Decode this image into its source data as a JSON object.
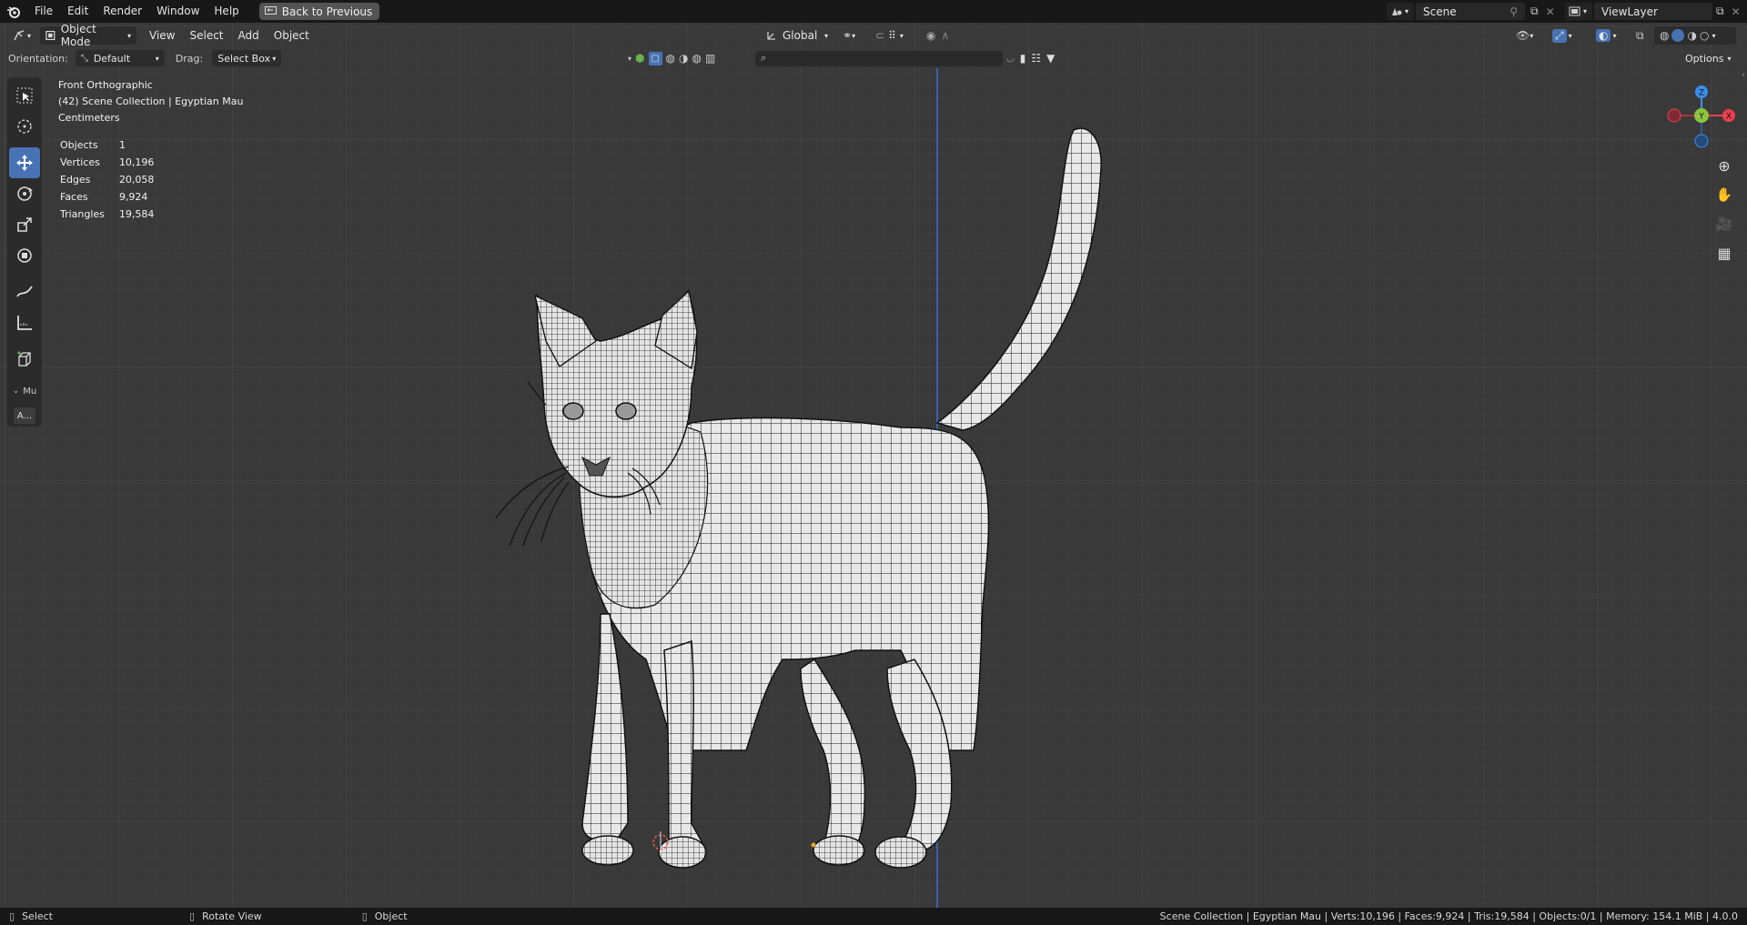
{
  "menu": {
    "items": [
      "File",
      "Edit",
      "Render",
      "Window",
      "Help"
    ],
    "back_label": "Back to Previous"
  },
  "topright": {
    "scene": "Scene",
    "view_layer": "ViewLayer"
  },
  "viewport_header": {
    "mode": "Object Mode",
    "menus": [
      "View",
      "Select",
      "Add",
      "Object"
    ],
    "transform_orientation": "Global",
    "orientation_label": "Orientation:",
    "orientation_value": "Default",
    "drag_label": "Drag:",
    "drag_value": "Select Box",
    "options_label": "Options",
    "search_placeholder": ""
  },
  "overlay": {
    "view_name": "Front Orthographic",
    "collection": "(42) Scene Collection | Egyptian Mau",
    "units": "Centimeters"
  },
  "stats": [
    {
      "label": "Objects",
      "value": "1"
    },
    {
      "label": "Vertices",
      "value": "10,196"
    },
    {
      "label": "Edges",
      "value": "20,058"
    },
    {
      "label": "Faces",
      "value": "9,924"
    },
    {
      "label": "Triangles",
      "value": "19,584"
    }
  ],
  "toolbar": {
    "collapsed_panel_label": "Mu",
    "small_btn_label": "A..."
  },
  "gizmo": {
    "x": "X",
    "y": "Y",
    "z": "Z"
  },
  "status": {
    "select": "Select",
    "rotate_view": "Rotate View",
    "object": "Object",
    "info": "Scene Collection | Egyptian Mau | Verts:10,196 | Faces:9,924 | Tris:19,584 | Objects:0/1 | Memory: 154.1 MiB | 4.0.0"
  },
  "colors": {
    "accent": "#4772b3",
    "axis_x": "#ee3f4f",
    "axis_y": "#8bc53f",
    "axis_z": "#3c8ef0",
    "viewport_bg": "#393939"
  }
}
